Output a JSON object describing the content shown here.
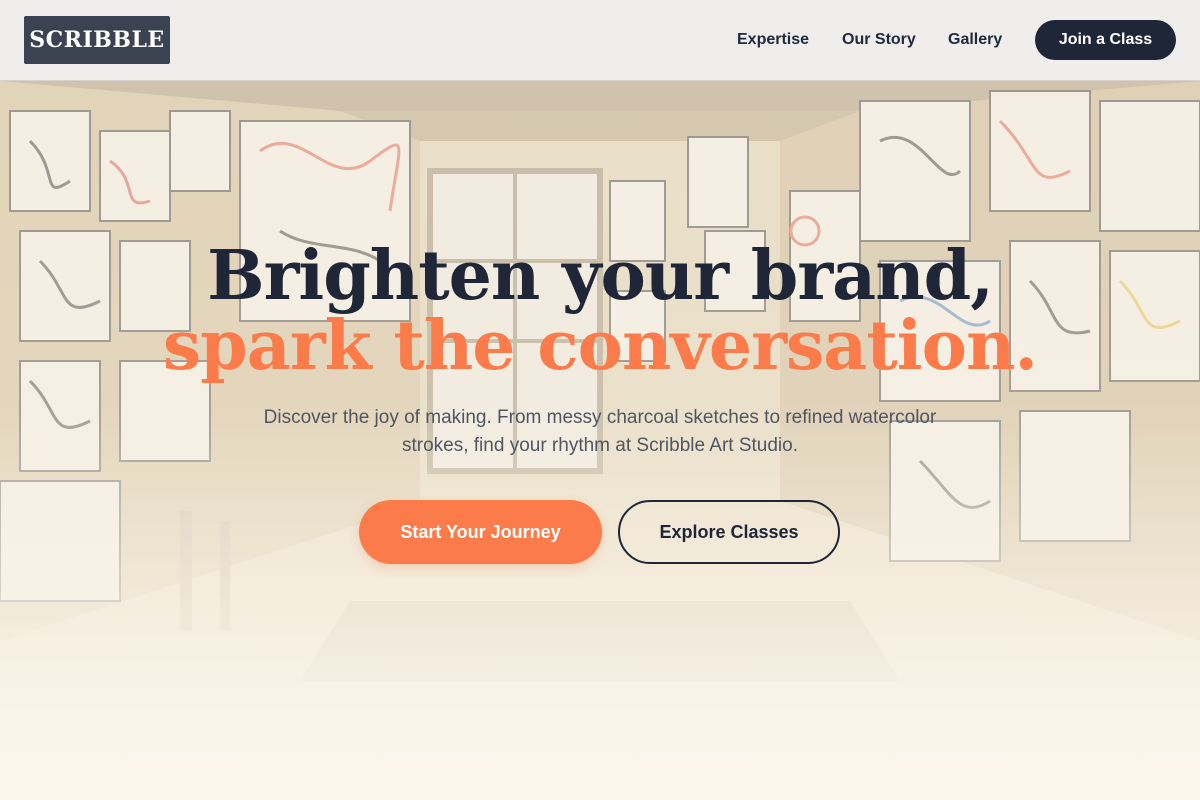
{
  "brand": {
    "logo_text": "SCRIBBLE"
  },
  "nav": {
    "items": [
      {
        "label": "Expertise"
      },
      {
        "label": "Our Story"
      },
      {
        "label": "Gallery"
      }
    ],
    "cta_label": "Join a Class"
  },
  "hero": {
    "headline_line1": "Brighten your brand,",
    "headline_line2": "spark the conversation.",
    "subtext": "Discover the joy of making. From messy charcoal sketches to refined watercolor strokes, find your rhythm at Scribble Art Studio.",
    "primary_button": "Start Your Journey",
    "secondary_button": "Explore Classes",
    "background_image": "art-studio-room-photo"
  },
  "colors": {
    "navy": "#1e2638",
    "accent_orange": "#fb7c4a",
    "logo_bg": "#3b4352",
    "header_bg": "#efeeec",
    "page_bg": "#fbf5ea"
  }
}
